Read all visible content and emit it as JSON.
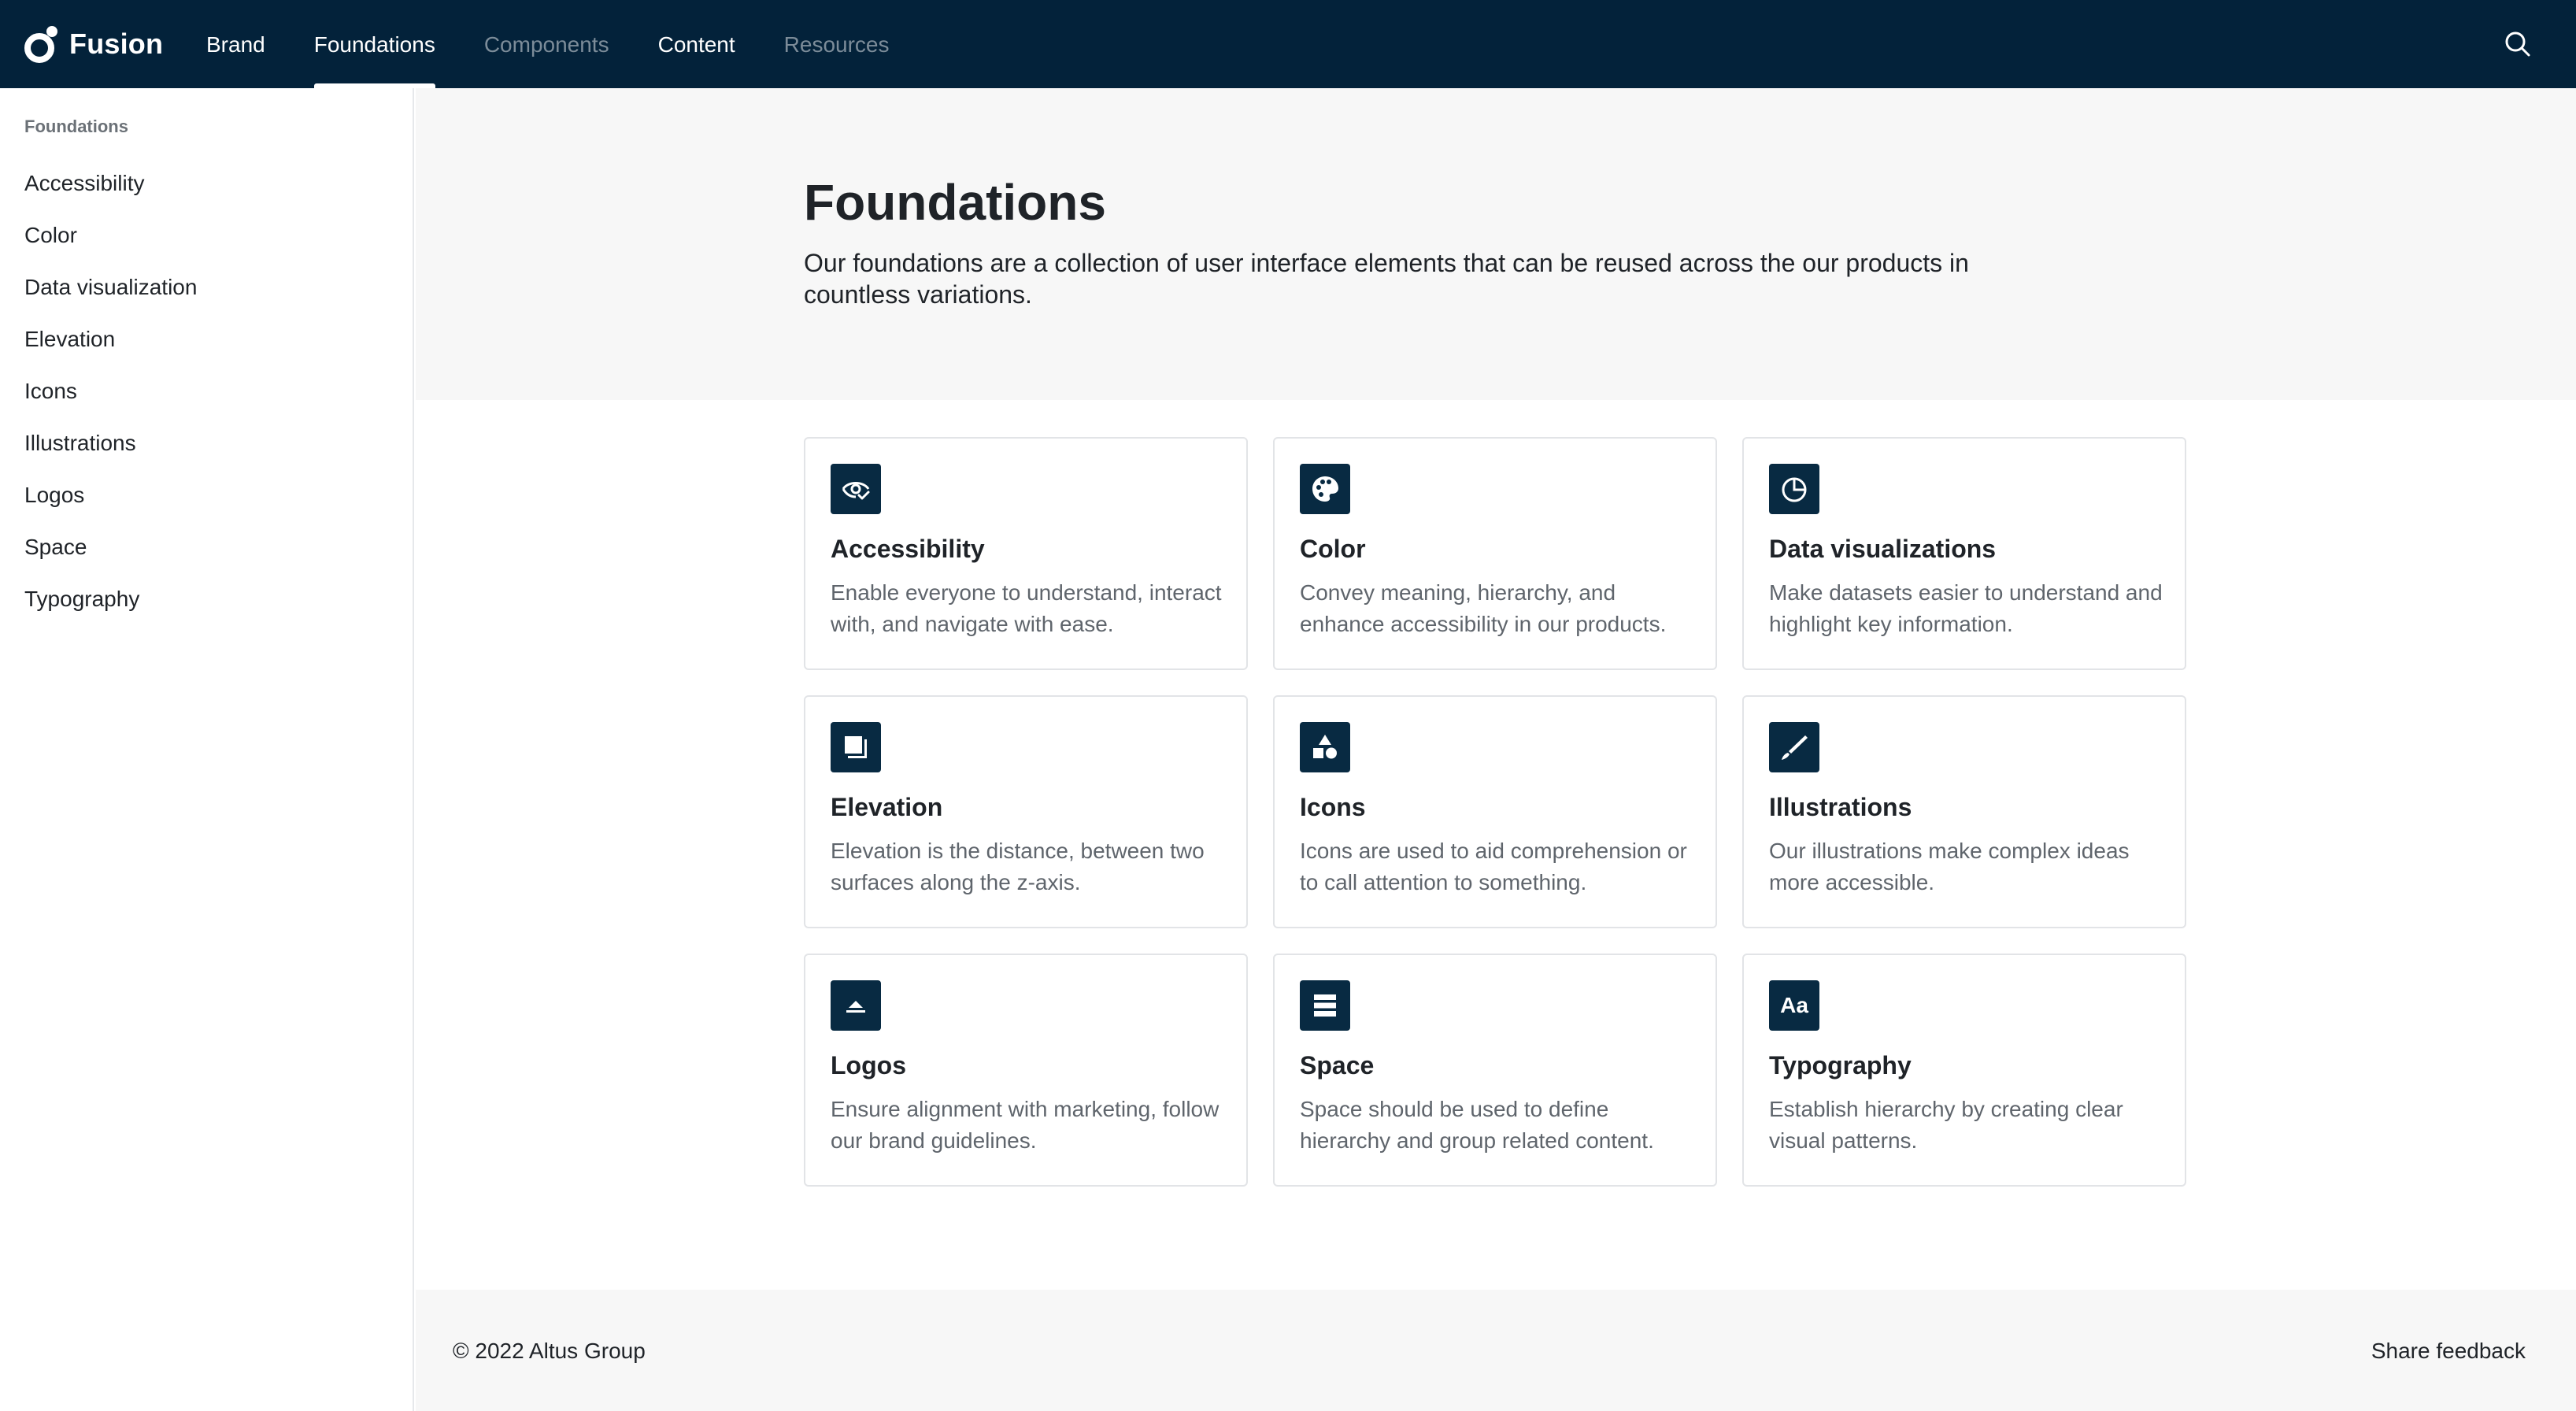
{
  "brand": {
    "name": "Fusion",
    "logo_icon": "fusion-logo-icon"
  },
  "nav": {
    "items": [
      {
        "label": "Brand",
        "state": "normal"
      },
      {
        "label": "Foundations",
        "state": "active"
      },
      {
        "label": "Components",
        "state": "dimmed"
      },
      {
        "label": "Content",
        "state": "normal"
      },
      {
        "label": "Resources",
        "state": "dimmed"
      }
    ],
    "search_icon": "search-icon"
  },
  "sidebar": {
    "heading": "Foundations",
    "items": [
      {
        "label": "Accessibility"
      },
      {
        "label": "Color"
      },
      {
        "label": "Data visualization"
      },
      {
        "label": "Elevation"
      },
      {
        "label": "Icons"
      },
      {
        "label": "Illustrations"
      },
      {
        "label": "Logos"
      },
      {
        "label": "Space"
      },
      {
        "label": "Typography"
      }
    ]
  },
  "hero": {
    "title": "Foundations",
    "description": "Our foundations are a collection of user interface elements that can be reused across the our products in countless variations."
  },
  "cards": [
    {
      "title": "Accessibility",
      "description": "Enable everyone to understand, interact with, and navigate with ease.",
      "icon": "accessibility-eye-icon"
    },
    {
      "title": "Color",
      "description": "Convey meaning, hierarchy, and enhance accessibility in our products.",
      "icon": "palette-icon"
    },
    {
      "title": "Data visualizations",
      "description": "Make datasets easier to understand and highlight key information.",
      "icon": "pie-chart-icon"
    },
    {
      "title": "Elevation",
      "description": "Elevation is the distance, between two surfaces along the z-axis.",
      "icon": "layers-icon"
    },
    {
      "title": "Icons",
      "description": "Icons are used to aid comprehension or to call attention to something.",
      "icon": "shapes-icon"
    },
    {
      "title": "Illustrations",
      "description": "Our illustrations make complex ideas more accessible.",
      "icon": "brush-icon"
    },
    {
      "title": "Logos",
      "description": "Ensure alignment with marketing, follow our brand guidelines.",
      "icon": "logo-mark-icon"
    },
    {
      "title": "Space",
      "description": "Space should be used to define hierarchy and group related content.",
      "icon": "spacing-icon"
    },
    {
      "title": "Typography",
      "description": "Establish hierarchy by creating clear visual patterns.",
      "icon": "typography-icon",
      "icon_text": "Aa"
    }
  ],
  "footer": {
    "copyright": "© 2022 Altus Group",
    "feedback_label": "Share feedback"
  },
  "colors": {
    "header_bg": "#03223a",
    "icon_tile_bg": "#082a42",
    "hero_bg": "#f7f7f7",
    "muted_nav": "#7c8c99"
  }
}
